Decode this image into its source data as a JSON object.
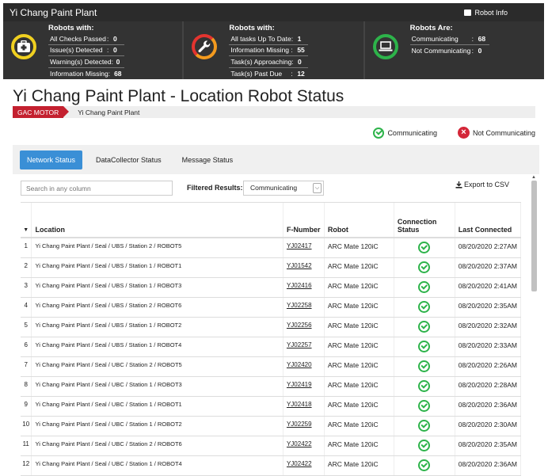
{
  "topbar": {
    "title": "Yi Chang Paint Plant",
    "robot_info": "Robot Info"
  },
  "panels": [
    {
      "head": "Robots with:",
      "icon": "first-aid-icon",
      "ring_color": "#f0d020",
      "rows": [
        {
          "label": "All Checks Passed",
          "value": "0"
        },
        {
          "label": "Issue(s) Detected",
          "value": "0"
        },
        {
          "label": "Warning(s) Detected",
          "value": "0"
        },
        {
          "label": "Information Missing",
          "value": "68"
        }
      ]
    },
    {
      "head": "Robots with:",
      "icon": "wrench-icon",
      "ring_color": "#f39a1e",
      "rows": [
        {
          "label": "All tasks Up To Date",
          "value": "1"
        },
        {
          "label": "Information Missing",
          "value": "55"
        },
        {
          "label": "Task(s) Approaching",
          "value": "0"
        },
        {
          "label": "Task(s) Past Due",
          "value": "12"
        }
      ]
    },
    {
      "head": "Robots Are:",
      "icon": "laptop-icon",
      "ring_color": "#2db34a",
      "rows": [
        {
          "label": "Communicating",
          "value": "68"
        },
        {
          "label": "Not Communicating",
          "value": "0"
        }
      ]
    }
  ],
  "page_title": "Yi Chang Paint Plant - Location Robot Status",
  "breadcrumb": {
    "root": "GAC MOTOR",
    "current": "Yi Chang Paint Plant"
  },
  "legend": {
    "communicating": "Communicating",
    "not_communicating": "Not Communicating"
  },
  "tabs": [
    "Network Status",
    "DataCollector Status",
    "Message Status"
  ],
  "toolbar": {
    "search_placeholder": "Search in any column",
    "filter_label": "Filtered Results:",
    "filter_value": "Communicating",
    "export_label": "Export to CSV"
  },
  "table": {
    "columns": [
      "Location",
      "F-Number",
      "Robot",
      "Connection Status",
      "Last Connected"
    ],
    "rows": [
      {
        "n": "1",
        "location": "Yi Chang Paint Plant / Seal / UBS / Station 2 / ROBOT5",
        "fnum": "YJ02417",
        "robot": "ARC Mate 120iC",
        "last": "08/20/2020 2:27AM"
      },
      {
        "n": "2",
        "location": "Yi Chang Paint Plant / Seal / UBS / Station 1 / ROBOT1",
        "fnum": "YJ01542",
        "robot": "ARC Mate 120iC",
        "last": "08/20/2020 2:37AM"
      },
      {
        "n": "3",
        "location": "Yi Chang Paint Plant / Seal / UBS / Station 1 / ROBOT3",
        "fnum": "YJ02416",
        "robot": "ARC Mate 120iC",
        "last": "08/20/2020 2:41AM"
      },
      {
        "n": "4",
        "location": "Yi Chang Paint Plant / Seal / UBS / Station 2 / ROBOT6",
        "fnum": "YJ02258",
        "robot": "ARC Mate 120iC",
        "last": "08/20/2020 2:35AM"
      },
      {
        "n": "5",
        "location": "Yi Chang Paint Plant / Seal / UBS / Station 1 / ROBOT2",
        "fnum": "YJ02256",
        "robot": "ARC Mate 120iC",
        "last": "08/20/2020 2:32AM"
      },
      {
        "n": "6",
        "location": "Yi Chang Paint Plant / Seal / UBS / Station 1 / ROBOT4",
        "fnum": "YJ02257",
        "robot": "ARC Mate 120iC",
        "last": "08/20/2020 2:33AM"
      },
      {
        "n": "7",
        "location": "Yi Chang Paint Plant / Seal / UBC / Station 2 / ROBOT5",
        "fnum": "YJ02420",
        "robot": "ARC Mate 120iC",
        "last": "08/20/2020 2:26AM"
      },
      {
        "n": "8",
        "location": "Yi Chang Paint Plant / Seal / UBC / Station 1 / ROBOT3",
        "fnum": "YJ02419",
        "robot": "ARC Mate 120iC",
        "last": "08/20/2020 2:28AM"
      },
      {
        "n": "9",
        "location": "Yi Chang Paint Plant / Seal / UBC / Station 1 / ROBOT1",
        "fnum": "YJ02418",
        "robot": "ARC Mate 120iC",
        "last": "08/20/2020 2:36AM"
      },
      {
        "n": "10",
        "location": "Yi Chang Paint Plant / Seal / UBC / Station 1 / ROBOT2",
        "fnum": "YJ02259",
        "robot": "ARC Mate 120iC",
        "last": "08/20/2020 2:30AM"
      },
      {
        "n": "11",
        "location": "Yi Chang Paint Plant / Seal / UBC / Station 2 / ROBOT6",
        "fnum": "YJ02422",
        "robot": "ARC Mate 120iC",
        "last": "08/20/2020 2:35AM"
      },
      {
        "n": "12",
        "location": "Yi Chang Paint Plant / Seal / UBC / Station 1 / ROBOT4",
        "fnum": "YJ02422",
        "robot": "ARC Mate 120iC",
        "last": "08/20/2020 2:36AM"
      }
    ]
  }
}
